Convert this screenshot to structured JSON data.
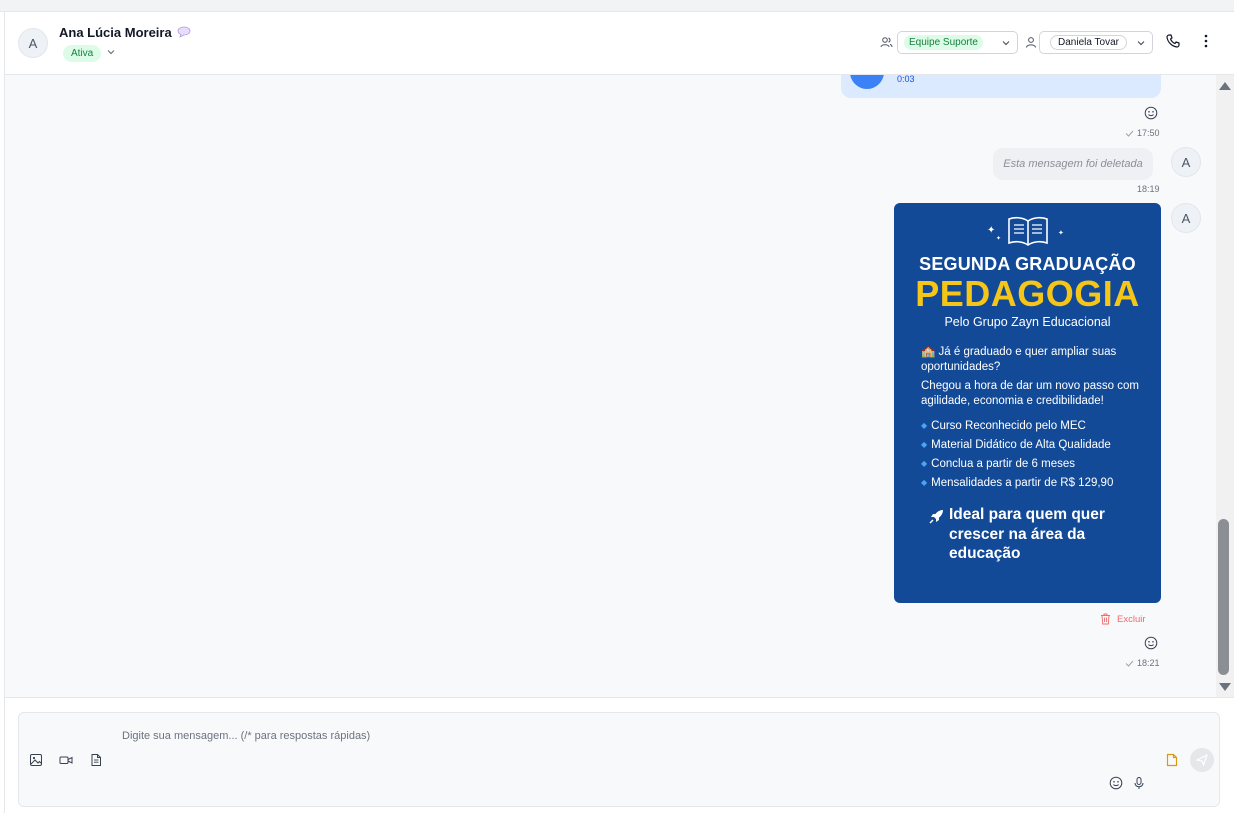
{
  "header": {
    "contact_initial": "A",
    "contact_name": "Ana Lúcia Moreira",
    "status": "Ativa",
    "team": "Equipe Suporte",
    "agent": "Daniela Tovar"
  },
  "messages": {
    "audio": {
      "duration": "0:03",
      "time": "17:50"
    },
    "deleted": {
      "text": "Esta mensagem foi deletada",
      "time": "18:19",
      "avatar_initial": "A"
    },
    "image": {
      "avatar_initial": "A",
      "line1": "SEGUNDA GRADUAÇÃO",
      "title": "PEDAGOGIA",
      "subtitle": "Pelo Grupo Zayn Educacional",
      "para1": "🏫 Já é graduado e quer ampliar suas oportunidades?",
      "para2": "Chegou a hora de dar um novo passo com agilidade, economia e credibilidade!",
      "bullets": [
        "Curso Reconhecido pelo MEC",
        "Material Didático de Alta Qualidade",
        "Conclua a partir de 6 meses",
        "Mensalidades a partir de R$ 129,90"
      ],
      "cta": "Ideal para quem quer crescer na área da educação",
      "delete_label": "Excluir",
      "time": "18:21"
    }
  },
  "composer": {
    "placeholder": "Digite sua mensagem... (/* para respostas rápidas)"
  },
  "colors": {
    "card_bg": "#134a98",
    "card_title": "#f5c518",
    "status_green": "#15803d",
    "audio_blue": "#3b82f6"
  }
}
